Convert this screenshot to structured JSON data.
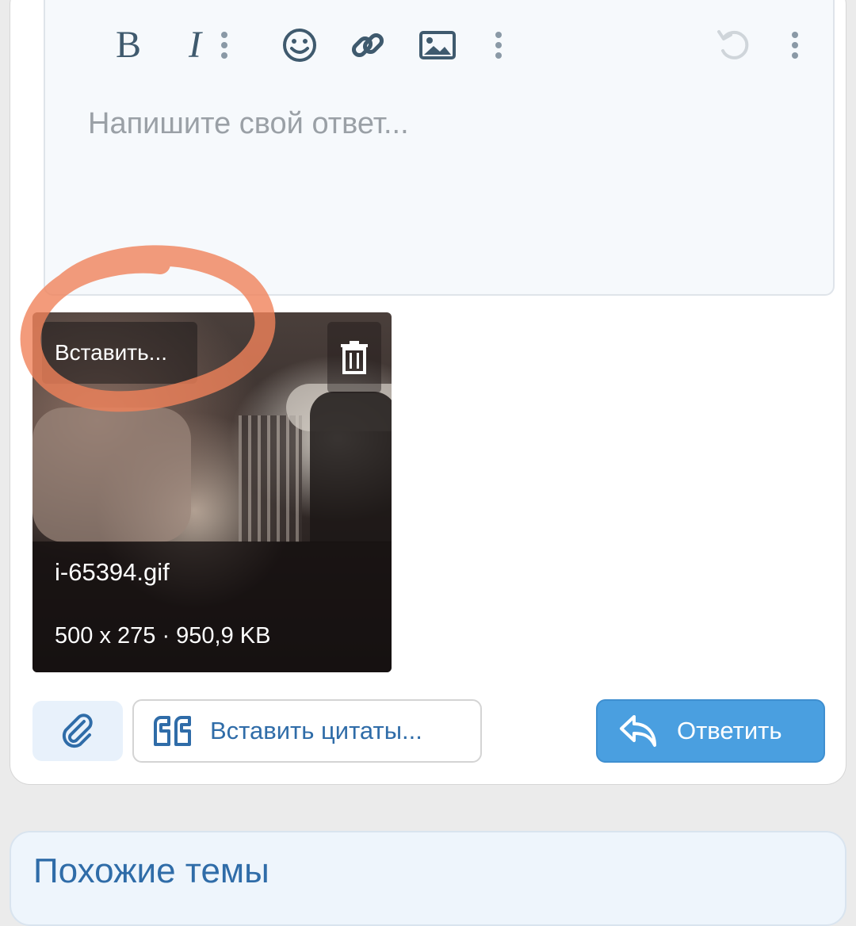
{
  "toolbar": {
    "bold_label": "B",
    "italic_label": "I"
  },
  "editor": {
    "placeholder": "Напишите свой ответ..."
  },
  "attachment": {
    "insert_label": "Вставить...",
    "filename": "i-65394.gif",
    "meta": "500 x 275 · 950,9 KB"
  },
  "actions": {
    "quote_label": "Вставить цитаты...",
    "reply_label": "Ответить"
  },
  "similar": {
    "title": "Похожие темы"
  },
  "colors": {
    "accent": "#4a9fe0",
    "link": "#2f6ca8",
    "annotation": "#f0825a"
  }
}
